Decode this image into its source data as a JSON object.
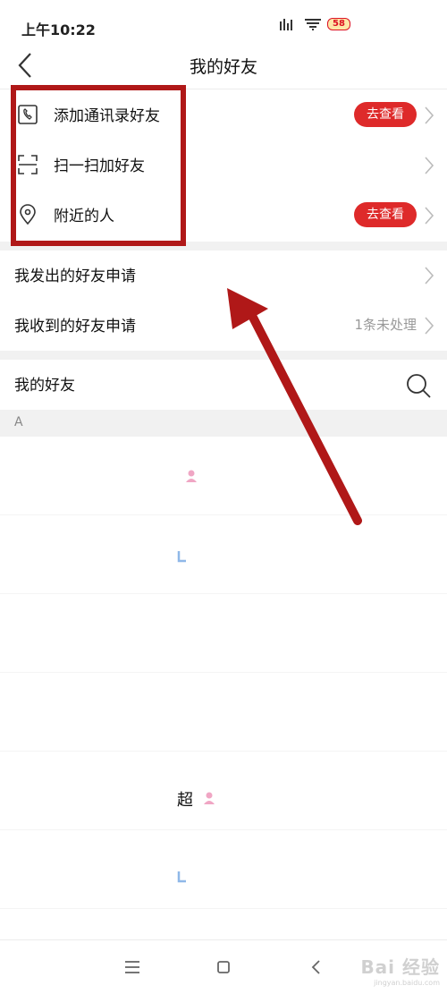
{
  "status_bar": {
    "time": "上午10:22",
    "battery": "58"
  },
  "nav": {
    "title": "我的好友"
  },
  "contact_options": [
    {
      "label": "添加通讯录好友",
      "action_label": "去查看",
      "icon": "phone-icon"
    },
    {
      "label": "扫一扫加好友",
      "action_label": "",
      "icon": "scan-icon"
    },
    {
      "label": "附近的人",
      "action_label": "去查看",
      "icon": "location-pin-icon"
    }
  ],
  "requests": [
    {
      "label": "我发出的好友申请",
      "value": ""
    },
    {
      "label": "我收到的好友申请",
      "value": "1条未处理"
    }
  ],
  "friends_section": {
    "title": "我的好友",
    "index_letter": "A",
    "visible_names": [
      "超"
    ]
  },
  "watermark": {
    "text": "Bai 经验",
    "sub": "jingyan.baidu.com"
  },
  "colors": {
    "accent": "#de2a2a",
    "annotation": "#b01818"
  }
}
